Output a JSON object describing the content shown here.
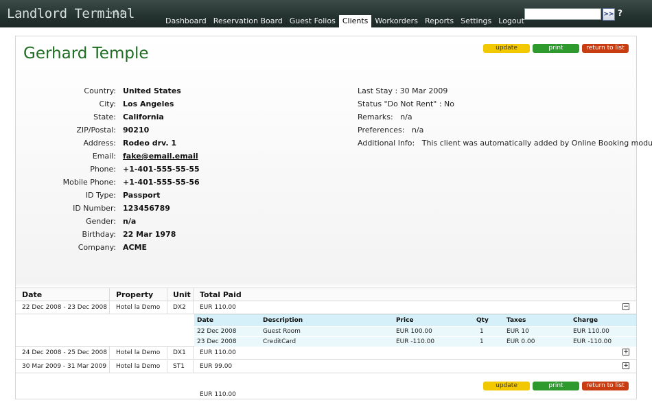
{
  "app": {
    "title": "Landlord Terminal",
    "version": "v.3.0"
  },
  "nav": {
    "items": [
      "Dashboard",
      "Reservation Board",
      "Guest Folios",
      "Clients",
      "Workorders",
      "Reports",
      "Settings",
      "Logout"
    ],
    "active": "Clients"
  },
  "search": {
    "value": "",
    "button_label": ">>",
    "help_label": "?"
  },
  "buttons": {
    "update": "update",
    "print": "print",
    "return": "return to list"
  },
  "colors": {
    "update": "#f2c800",
    "print": "#2e9a2e",
    "return": "#c83c12",
    "name": "#1e6b22",
    "topbar": "#243230"
  },
  "client": {
    "name": "Gerhard Temple",
    "fields": [
      {
        "label": "Country:",
        "value": "United States"
      },
      {
        "label": "City:",
        "value": "Los Angeles"
      },
      {
        "label": "State:",
        "value": "California"
      },
      {
        "label": "ZIP/Postal:",
        "value": "90210"
      },
      {
        "label": "Address:",
        "value": "Rodeo drv. 1"
      },
      {
        "label": "Email:",
        "value": "fake@email.email"
      },
      {
        "label": "Phone:",
        "value": "+1-401-555-55-55"
      },
      {
        "label": "Mobile Phone:",
        "value": "+1-401-555-55-56"
      },
      {
        "label": "ID Type:",
        "value": "Passport"
      },
      {
        "label": "ID Number:",
        "value": "123456789"
      },
      {
        "label": "Gender:",
        "value": "n/a"
      },
      {
        "label": "Birthday:",
        "value": "22 Mar 1978"
      },
      {
        "label": "Company:",
        "value": "ACME"
      }
    ],
    "info": [
      "Last Stay : 30 Mar 2009",
      "Status \"Do Not Rent\" : No",
      "Remarks:   n/a",
      "Preferences:   n/a",
      "Additional Info:   This client was automatically added by Online Booking module"
    ]
  },
  "reservations": {
    "headers": [
      "Date",
      "Property",
      "Unit",
      "Total Paid"
    ],
    "rows": [
      {
        "date": "22 Dec 2008 - 23 Dec 2008",
        "property": "Hotel la Demo",
        "unit": "DX2",
        "total": "EUR 110.00",
        "toggle": "−"
      },
      {
        "date": "24 Dec 2008 - 25 Dec 2008",
        "property": "Hotel la Demo",
        "unit": "DX1",
        "total": "EUR 110.00",
        "toggle": "+"
      },
      {
        "date": "30 Mar 2009 - 31 Mar 2009",
        "property": "Hotel la Demo",
        "unit": "ST1",
        "total": "EUR 99.00",
        "toggle": "+"
      }
    ],
    "detail_headers": [
      "Date",
      "Description",
      "Price",
      "Qty",
      "Taxes",
      "Charge"
    ],
    "detail_rows": [
      [
        "22 Dec 2008",
        "Guest Room",
        "EUR 100.00",
        "1",
        "EUR 10",
        "EUR 110.00"
      ],
      [
        "23 Dec 2008",
        "CreditCard",
        "EUR -110.00",
        "1",
        "EUR 0.00",
        "EUR -110.00"
      ]
    ],
    "grand_total": "EUR 110.00"
  }
}
